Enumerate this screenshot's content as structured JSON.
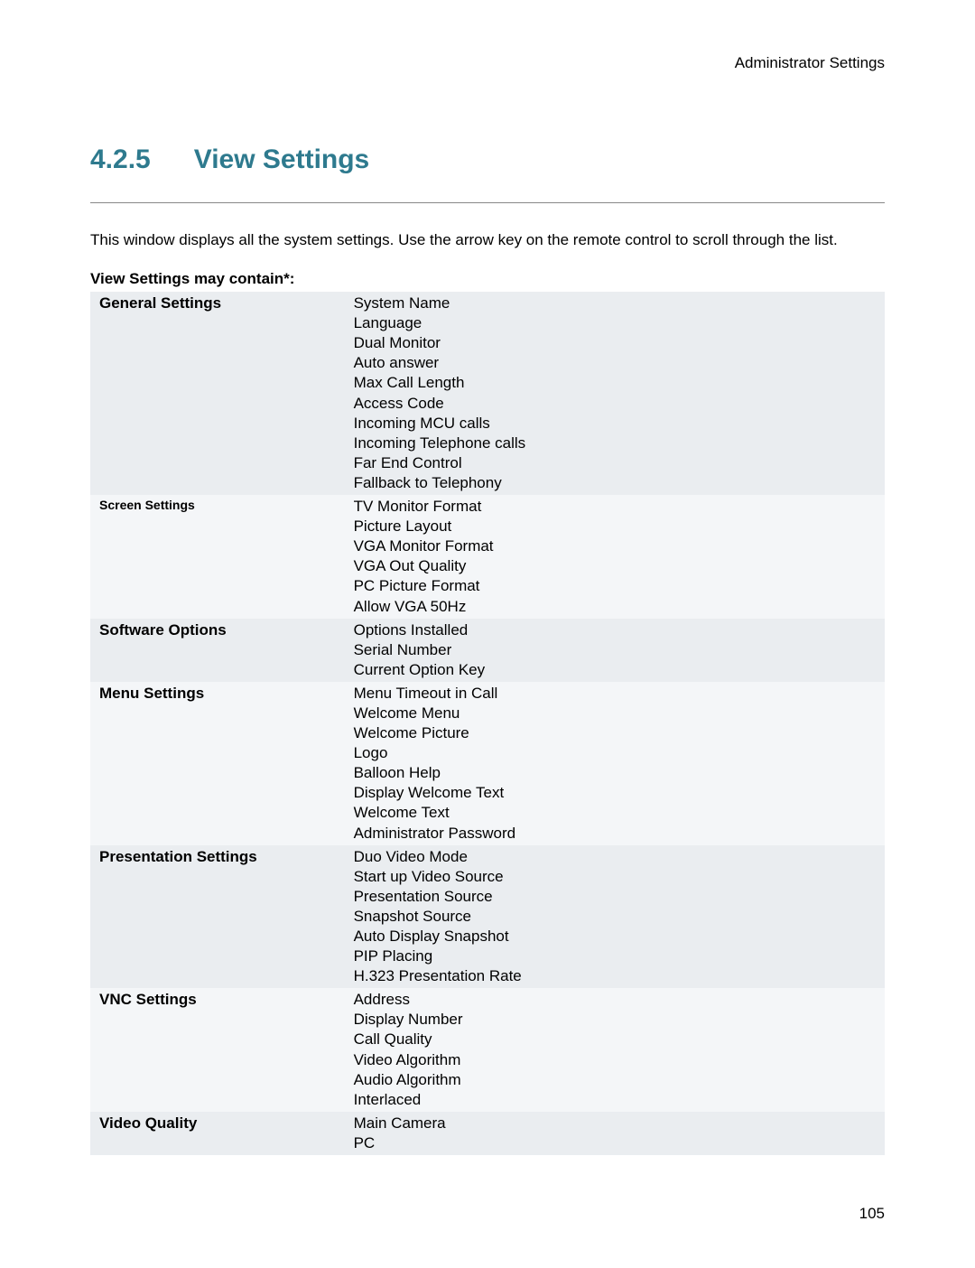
{
  "header": {
    "title": "Administrator Settings"
  },
  "section": {
    "number": "4.2.5",
    "title": "View Settings"
  },
  "intro": "This window displays all the system settings. Use the arrow key on the remote control to scroll through the list.",
  "table": {
    "title": "View Settings may contain*:",
    "rows": [
      {
        "label": "General Settings",
        "smallLabel": false,
        "values": "System Name\nLanguage\nDual Monitor\nAuto answer\nMax Call Length\nAccess Code\nIncoming MCU calls\nIncoming Telephone calls\nFar End Control\nFallback to Telephony"
      },
      {
        "label": "Screen Settings",
        "smallLabel": true,
        "values": "TV Monitor Format\nPicture Layout\nVGA Monitor Format\nVGA Out Quality\nPC Picture Format\nAllow VGA 50Hz"
      },
      {
        "label": "Software Options",
        "smallLabel": false,
        "values": "Options Installed\nSerial Number\nCurrent Option Key"
      },
      {
        "label": "Menu Settings",
        "smallLabel": false,
        "values": "Menu Timeout in Call\nWelcome Menu\nWelcome Picture\nLogo\nBalloon Help\nDisplay Welcome Text\nWelcome Text\nAdministrator Password"
      },
      {
        "label": "Presentation Settings",
        "smallLabel": false,
        "values": "Duo Video Mode\nStart up Video Source\nPresentation Source\nSnapshot Source\nAuto Display Snapshot\nPIP Placing\nH.323 Presentation Rate"
      },
      {
        "label": "VNC Settings",
        "smallLabel": false,
        "values": "Address\nDisplay Number\nCall Quality\nVideo Algorithm\nAudio Algorithm\nInterlaced"
      },
      {
        "label": "Video Quality",
        "smallLabel": false,
        "values": "Main Camera\nPC"
      }
    ]
  },
  "pageNumber": "105"
}
